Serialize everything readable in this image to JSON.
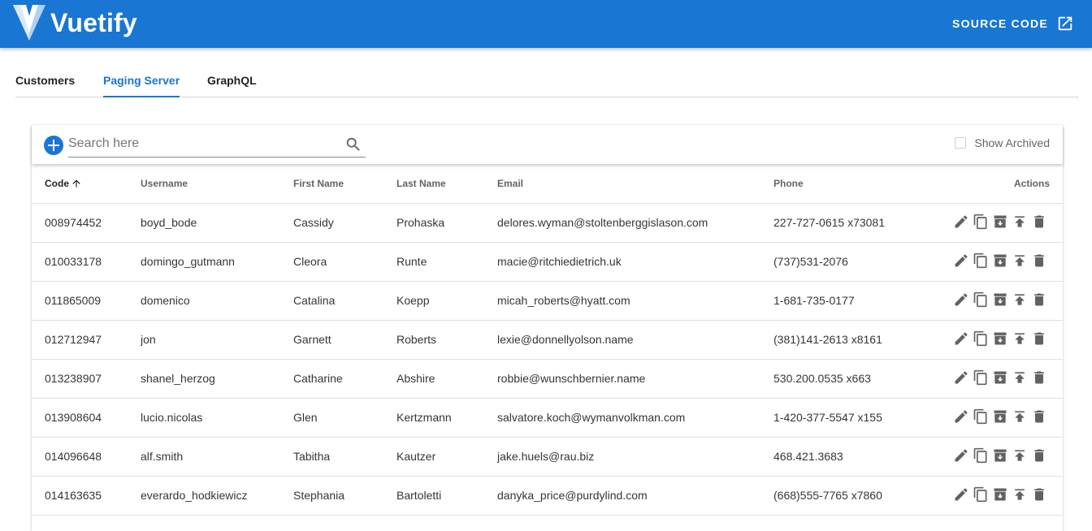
{
  "app": {
    "brand": "Vuetify",
    "source_label": "SOURCE CODE"
  },
  "tabs": [
    {
      "label": "Customers",
      "active": false
    },
    {
      "label": "Paging Server",
      "active": true
    },
    {
      "label": "GraphQL",
      "active": false
    }
  ],
  "toolbar": {
    "search_placeholder": "Search here",
    "search_value": "",
    "archived_label": "Show Archived",
    "archived_checked": false
  },
  "table": {
    "headers": [
      "Code",
      "Username",
      "First Name",
      "Last Name",
      "Email",
      "Phone",
      "Actions"
    ],
    "sort": {
      "column": "Code",
      "direction": "ascending"
    },
    "rows": [
      [
        "008974452",
        "boyd_bode",
        "Cassidy",
        "Prohaska",
        "delores.wyman@stoltenberggislason.com",
        "227-727-0615 x73081"
      ],
      [
        "010033178",
        "domingo_gutmann",
        "Cleora",
        "Runte",
        "macie@ritchiedietrich.uk",
        "(737)531-2076"
      ],
      [
        "011865009",
        "domenico",
        "Catalina",
        "Koepp",
        "micah_roberts@hyatt.com",
        "1-681-735-0177"
      ],
      [
        "012712947",
        "jon",
        "Garnett",
        "Roberts",
        "lexie@donnellyolson.name",
        "(381)141-2613 x8161"
      ],
      [
        "013238907",
        "shanel_herzog",
        "Catharine",
        "Abshire",
        "robbie@wunschbernier.name",
        "530.200.0535 x663"
      ],
      [
        "013908604",
        "lucio.nicolas",
        "Glen",
        "Kertzmann",
        "salvatore.koch@wymanvolkman.com",
        "1-420-377-5547 x155"
      ],
      [
        "014096648",
        "alf.smith",
        "Tabitha",
        "Kautzer",
        "jake.huels@rau.biz",
        "468.421.3683"
      ],
      [
        "014163635",
        "everardo_hodkiewicz",
        "Stephania",
        "Bartoletti",
        "danyka_price@purdylind.com",
        "(668)555-7765 x7860"
      ]
    ],
    "row_actions": [
      "edit-icon",
      "copy-icon",
      "archive-icon",
      "upload-icon",
      "delete-icon"
    ]
  },
  "colors": {
    "primary": "#1976d2",
    "icon": "#616161"
  }
}
